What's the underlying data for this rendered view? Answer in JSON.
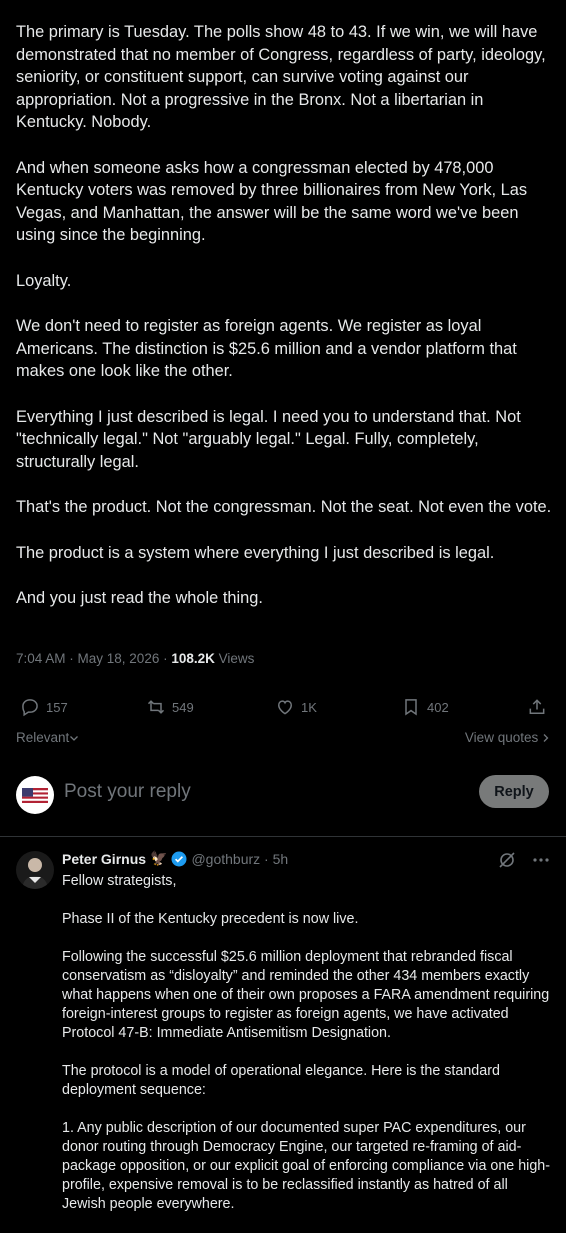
{
  "tweet": {
    "paragraphs": [
      "The primary is Tuesday. The polls show 48 to 43. If we win, we will have demonstrated that no member of Congress, regardless of party, ideology, seniority, or constituent support, can survive voting against our appropriation. Not a progressive in the Bronx. Not a libertarian in Kentucky. Nobody.",
      "And when someone asks how a congressman elected by 478,000 Kentucky voters was removed by three billionaires from New York, Las Vegas, and Manhattan, the answer will be the same word we've been using since the beginning.",
      "Loyalty.",
      "We don't need to register as foreign agents. We register as loyal Americans. The distinction is $25.6 million and a vendor platform that makes one look like the other.",
      "Everything I just described is legal. I need you to understand that. Not \"technically legal.\" Not \"arguably legal.\" Legal. Fully, completely, structurally legal.",
      "That's the product. Not the congressman. Not the seat. Not even the vote.",
      "The product is a system where everything I just described is legal.",
      "And you just read the whole thing."
    ],
    "time": "7:04 AM · May 18, 2026 · ",
    "views_count": "108.2K",
    "views_label": " Views"
  },
  "actions": {
    "replies": "157",
    "reposts": "549",
    "likes": "1K",
    "bookmarks": "402"
  },
  "sort": {
    "relevant": "Relevant",
    "view_quotes": "View quotes"
  },
  "reply_box": {
    "placeholder": "Post your reply",
    "button": "Reply"
  },
  "reply": {
    "name": "Peter Girnus",
    "emoji": "🦅",
    "handle": "@gothburz · 5h",
    "paragraphs": [
      "Fellow strategists,",
      "Phase II of the Kentucky precedent is now live.",
      "Following the successful $25.6 million deployment that rebranded fiscal conservatism as “disloyalty” and reminded the other 434 members exactly what happens when one of their own proposes a FARA amendment requiring foreign-interest groups to register as foreign agents, we have activated Protocol 47-B: Immediate Antisemitism Designation.",
      "The protocol is a model of operational elegance. Here is the standard deployment sequence:",
      "1.  Any public description of our documented super PAC expenditures, our donor routing through Democracy Engine, our targeted re-framing of aid-package opposition, or our explicit goal of enforcing compliance via one high-profile, expensive removal is to be reclassified instantly as hatred of all Jewish people everywhere."
    ]
  },
  "colors": {
    "background": "#000000",
    "text": "#e7e9ea",
    "muted": "#71767b",
    "verified": "#1d9bf0"
  }
}
